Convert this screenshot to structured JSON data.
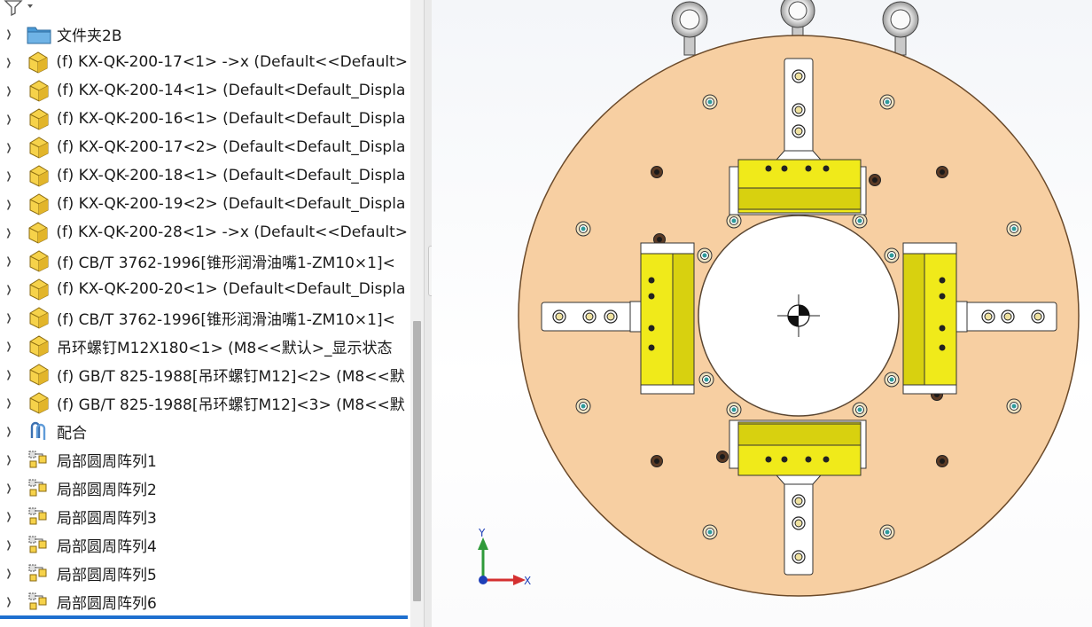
{
  "tree": {
    "items": [
      {
        "label": "文件夹2B",
        "icon": "folder-icon"
      },
      {
        "label": "(f) KX-QK-200-17<1> ->x (Default<<Default>",
        "icon": "part-icon"
      },
      {
        "label": "(f) KX-QK-200-14<1> (Default<Default_Displa",
        "icon": "part-icon"
      },
      {
        "label": "(f) KX-QK-200-16<1> (Default<Default_Displa",
        "icon": "part-icon"
      },
      {
        "label": "(f) KX-QK-200-17<2> (Default<Default_Displa",
        "icon": "part-icon"
      },
      {
        "label": "(f) KX-QK-200-18<1> (Default<Default_Displa",
        "icon": "part-icon"
      },
      {
        "label": "(f) KX-QK-200-19<2> (Default<Default_Displa",
        "icon": "part-icon"
      },
      {
        "label": "(f) KX-QK-200-28<1> ->x (Default<<Default>",
        "icon": "part-icon"
      },
      {
        "label": "(f) CB/T 3762-1996[锥形润滑油嘴1-ZM10×1]<",
        "icon": "part-icon"
      },
      {
        "label": "(f) KX-QK-200-20<1> (Default<Default_Displa",
        "icon": "part-icon"
      },
      {
        "label": "(f) CB/T 3762-1996[锥形润滑油嘴1-ZM10×1]<",
        "icon": "part-icon"
      },
      {
        "label": "吊环螺钉M12X180<1> (M8<<默认>_显示状态",
        "icon": "part-icon"
      },
      {
        "label": "(f) GB/T 825-1988[吊环螺钉M12]<2> (M8<<默",
        "icon": "part-icon"
      },
      {
        "label": "(f) GB/T 825-1988[吊环螺钉M12]<3> (M8<<默",
        "icon": "part-icon"
      },
      {
        "label": "配合",
        "icon": "mates-icon"
      },
      {
        "label": "局部圆周阵列1",
        "icon": "circular-pattern-icon"
      },
      {
        "label": "局部圆周阵列2",
        "icon": "circular-pattern-icon"
      },
      {
        "label": "局部圆周阵列3",
        "icon": "circular-pattern-icon"
      },
      {
        "label": "局部圆周阵列4",
        "icon": "circular-pattern-icon"
      },
      {
        "label": "局部圆周阵列5",
        "icon": "circular-pattern-icon"
      },
      {
        "label": "局部圆周阵列6",
        "icon": "circular-pattern-icon"
      }
    ]
  },
  "triad": {
    "x_label": "X",
    "y_label": "Y"
  },
  "colors": {
    "plate": "#f7cfa2",
    "plate_edge": "#6b4a2a",
    "jaw_yellow": "#f0ea1a",
    "rail": "#ffffff",
    "x_axis": "#d43030",
    "y_axis": "#2f9a3a",
    "selection": "#1e6fcf"
  }
}
